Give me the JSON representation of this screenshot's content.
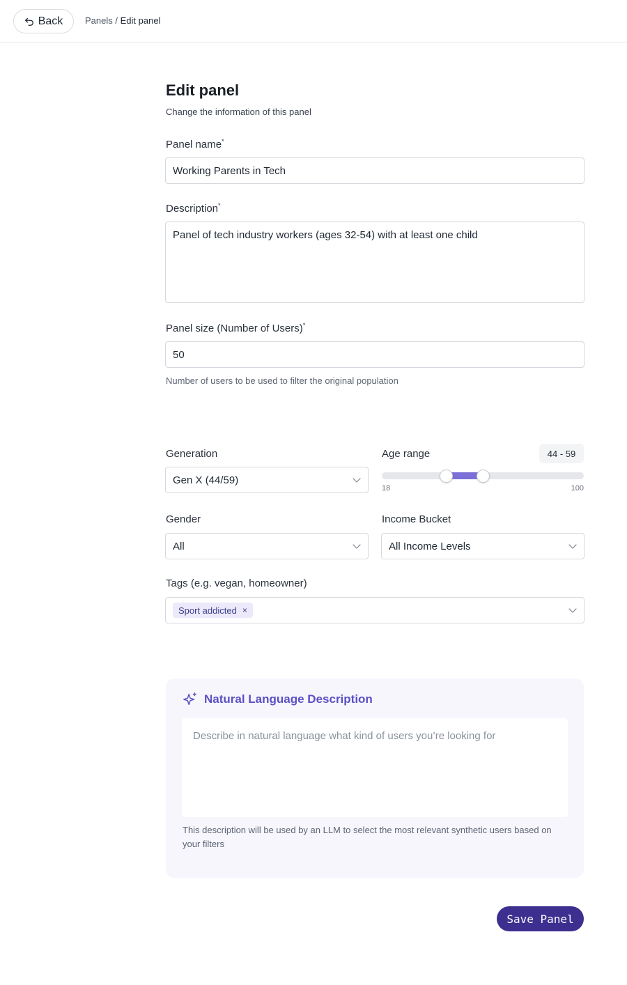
{
  "header": {
    "back_label": "Back",
    "breadcrumb_parent": "Panels",
    "breadcrumb_separator": "/",
    "breadcrumb_current": "Edit panel"
  },
  "form": {
    "title": "Edit panel",
    "subtitle": "Change the information of this panel",
    "panel_name": {
      "label": "Panel name",
      "required_mark": "*",
      "value": "Working Parents in Tech"
    },
    "description": {
      "label": "Description",
      "required_mark": "*",
      "value": "Panel of tech industry workers (ages 32-54) with at least one child"
    },
    "panel_size": {
      "label": "Panel size (Number of Users)",
      "required_mark": "*",
      "value": "50",
      "help": "Number of users to be used to filter the original population"
    }
  },
  "filters": {
    "generation": {
      "label": "Generation",
      "value": "Gen X (44/59)"
    },
    "age_range": {
      "label": "Age range",
      "badge": "44 - 59",
      "min_label": "18",
      "max_label": "100",
      "min": 18,
      "max": 100,
      "low": 44,
      "high": 59
    },
    "gender": {
      "label": "Gender",
      "value": "All"
    },
    "income": {
      "label": "Income Bucket",
      "value": "All Income Levels"
    },
    "tags": {
      "label": "Tags (e.g. vegan, homeowner)",
      "items": [
        {
          "label": "Sport addicted",
          "remove": "×"
        }
      ]
    }
  },
  "natural_language": {
    "title": "Natural Language Description",
    "placeholder": "Describe in natural language what kind of users you’re looking for",
    "help": "This description will be used by an LLM to select the most relevant synthetic users based on your filters"
  },
  "actions": {
    "save_label": "Save Panel"
  },
  "colors": {
    "accent": "#7c6fd6",
    "primary": "#3d2f8f",
    "tag_bg": "#ece9fb",
    "card_bg": "#f7f6fd"
  },
  "icons": {
    "back": "undo-arrow-icon",
    "sparkle": "sparkle-icon",
    "chevron": "chevron-down-icon",
    "remove": "close-icon"
  }
}
